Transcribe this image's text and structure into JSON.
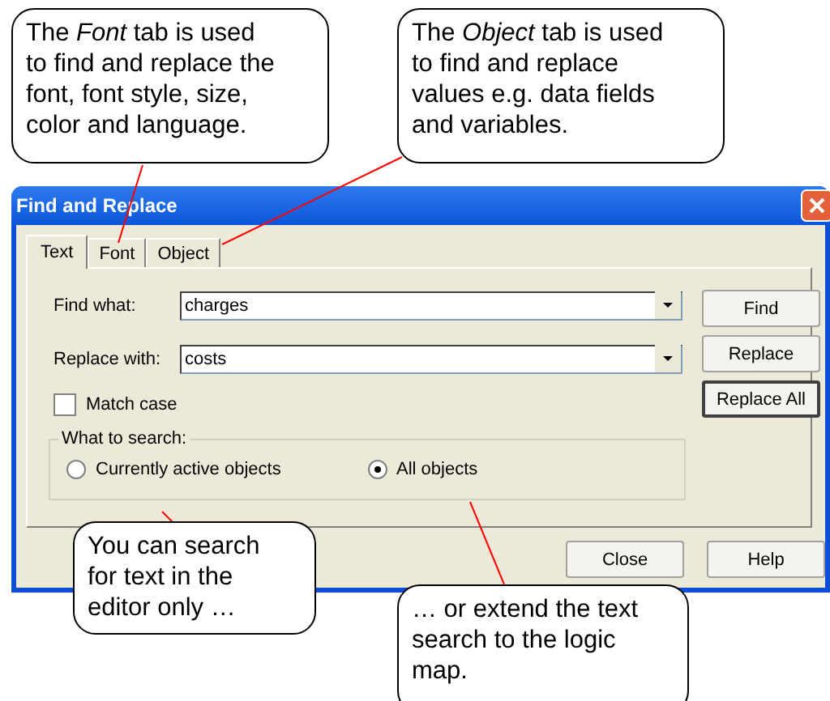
{
  "window": {
    "title": "Find and Replace"
  },
  "tabs": [
    {
      "label": "Text",
      "selected": true
    },
    {
      "label": "Font",
      "selected": false
    },
    {
      "label": "Object",
      "selected": false
    }
  ],
  "fields": [
    {
      "label": "Find what:",
      "value": "charges"
    },
    {
      "label": "Replace with:",
      "value": "costs"
    }
  ],
  "side_buttons": [
    "Find",
    "Replace",
    "Replace All"
  ],
  "match_case": {
    "label": "Match case",
    "checked": false
  },
  "search_scope": {
    "title": "What to search:",
    "options": [
      {
        "label": "Currently active objects",
        "selected": false
      },
      {
        "label": "All objects",
        "selected": true
      }
    ]
  },
  "buttons": [
    "Close",
    "Help"
  ],
  "callouts": [
    {
      "text": "The *Font* tab is used\nto find and replace the\nfont, font style, size,\ncolor and language."
    },
    {
      "text": "The *Object* tab is used\nto find and replace\nvalues e.g. data fields\nand variables."
    },
    {
      "text": "You can search\nfor text in the\neditor only …"
    },
    {
      "text": "… or extend the text\nsearch to the logic\nmap."
    }
  ]
}
